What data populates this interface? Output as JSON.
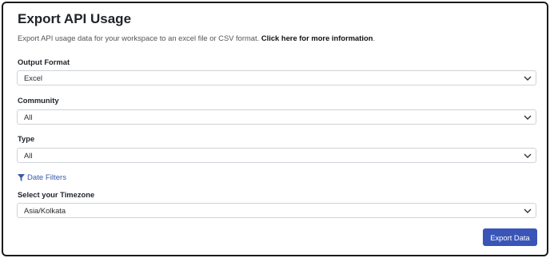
{
  "header": {
    "title": "Export API Usage",
    "description": "Export API usage data for your workspace to an excel file or CSV format.",
    "info_link": "Click here for more information"
  },
  "form": {
    "output_format": {
      "label": "Output Format",
      "value": "Excel"
    },
    "community": {
      "label": "Community",
      "value": "All"
    },
    "type": {
      "label": "Type",
      "value": "All"
    },
    "date_filters": {
      "label": "Date Filters",
      "icon": "filter-icon"
    },
    "timezone": {
      "label": "Select your Timezone",
      "value": "Asia/Kolkata"
    }
  },
  "actions": {
    "export_label": "Export Data"
  },
  "colors": {
    "accent": "#3a55b8",
    "link": "#3a5aa8"
  }
}
